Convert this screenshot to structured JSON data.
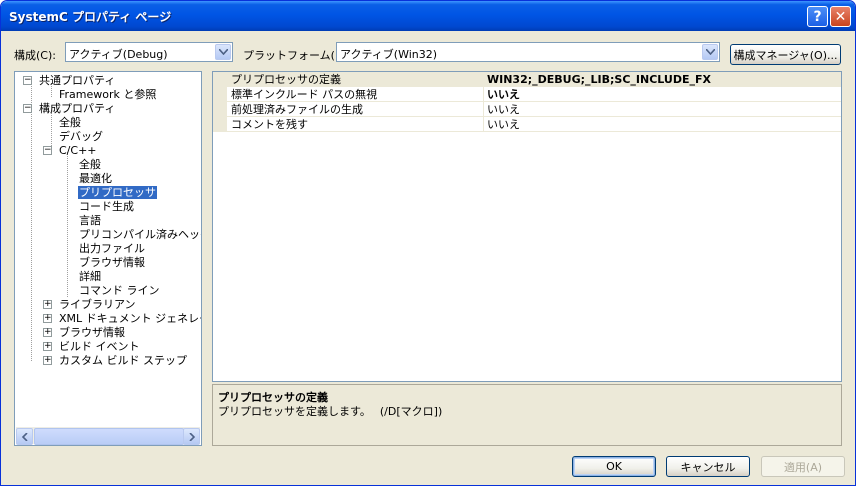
{
  "window": {
    "title": "SystemC プロパティ ページ",
    "help_label": "?",
    "close_label": "✕"
  },
  "config": {
    "label": "構成(C):",
    "value": "アクティブ(Debug)"
  },
  "platform": {
    "label": "プラットフォーム(P):",
    "value": "アクティブ(Win32)"
  },
  "config_manager_button": "構成マネージャ(O)...",
  "tree": {
    "items": [
      {
        "label": "共通プロパティ",
        "expander": "−"
      },
      {
        "label": "Framework と参照"
      },
      {
        "label": "構成プロパティ",
        "expander": "−"
      },
      {
        "label": "全般"
      },
      {
        "label": "デバッグ"
      },
      {
        "label": "C/C++",
        "expander": "−"
      },
      {
        "label": "全般"
      },
      {
        "label": "最適化"
      },
      {
        "label": "プリプロセッサ",
        "selected": true
      },
      {
        "label": "コード生成"
      },
      {
        "label": "言語"
      },
      {
        "label": "プリコンパイル済みヘッダー"
      },
      {
        "label": "出力ファイル"
      },
      {
        "label": "ブラウザ情報"
      },
      {
        "label": "詳細"
      },
      {
        "label": "コマンド ライン"
      },
      {
        "label": "ライブラリアン",
        "expander": "+"
      },
      {
        "label": "XML ドキュメント ジェネレータ",
        "expander": "+"
      },
      {
        "label": "ブラウザ情報",
        "expander": "+"
      },
      {
        "label": "ビルド イベント",
        "expander": "+"
      },
      {
        "label": "カスタム ビルド ステップ",
        "expander": "+"
      }
    ]
  },
  "properties": {
    "rows": [
      {
        "name": "プリプロセッサの定義",
        "value": "WIN32;_DEBUG;_LIB;SC_INCLUDE_FX",
        "bold": true
      },
      {
        "name": "標準インクルード パスの無視",
        "value": "いいえ",
        "bold": true
      },
      {
        "name": "前処理済みファイルの生成",
        "value": "いいえ",
        "bold": false
      },
      {
        "name": "コメントを残す",
        "value": "いいえ",
        "bold": false
      }
    ]
  },
  "description": {
    "title": "プリプロセッサの定義",
    "text": "プリプロセッサを定義します。　 (/D[マクロ])"
  },
  "buttons": {
    "ok": "OK",
    "cancel": "キャンセル",
    "apply": "適用(A)"
  },
  "colors": {
    "titlebar": "#0055e5",
    "selection": "#316ac5",
    "dialog": "#ece9d8"
  }
}
